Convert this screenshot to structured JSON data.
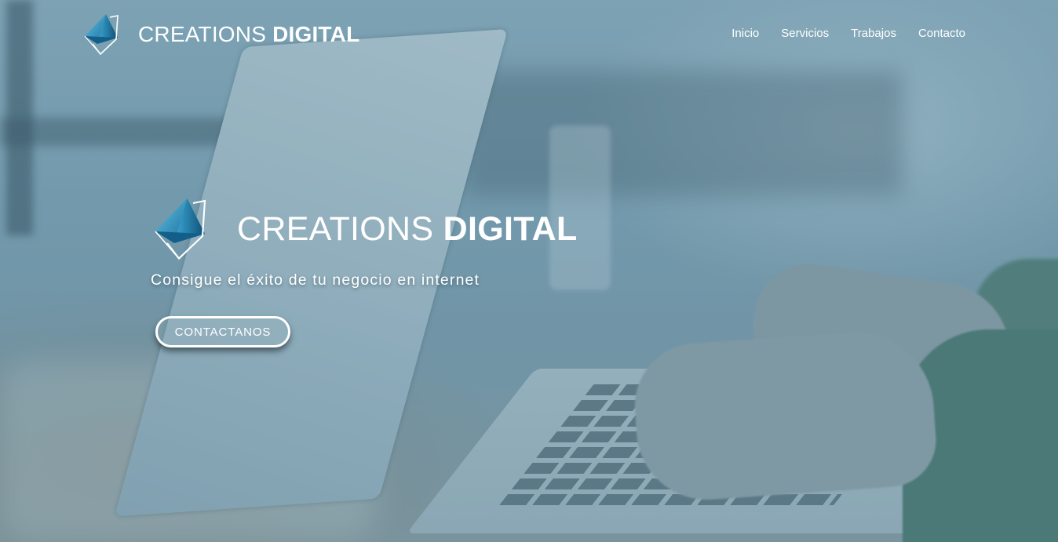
{
  "header": {
    "brand": {
      "light": "CREATIONS ",
      "bold": "DIGITAL",
      "logo_icon": "triangle-logo-icon"
    },
    "nav": [
      {
        "label": "Inicio"
      },
      {
        "label": "Servicios"
      },
      {
        "label": "Trabajos"
      },
      {
        "label": "Contacto"
      }
    ]
  },
  "hero": {
    "title": {
      "light": "CREATIONS ",
      "bold": "DIGITAL"
    },
    "subtitle": "Consigue el éxito de tu negocio en internet",
    "cta_label": "CONTACTANOS",
    "logo_icon": "triangle-logo-icon"
  },
  "colors": {
    "accent_teal": "#2a87b5",
    "text": "#ffffff",
    "overlay": "#5f8ca0"
  }
}
